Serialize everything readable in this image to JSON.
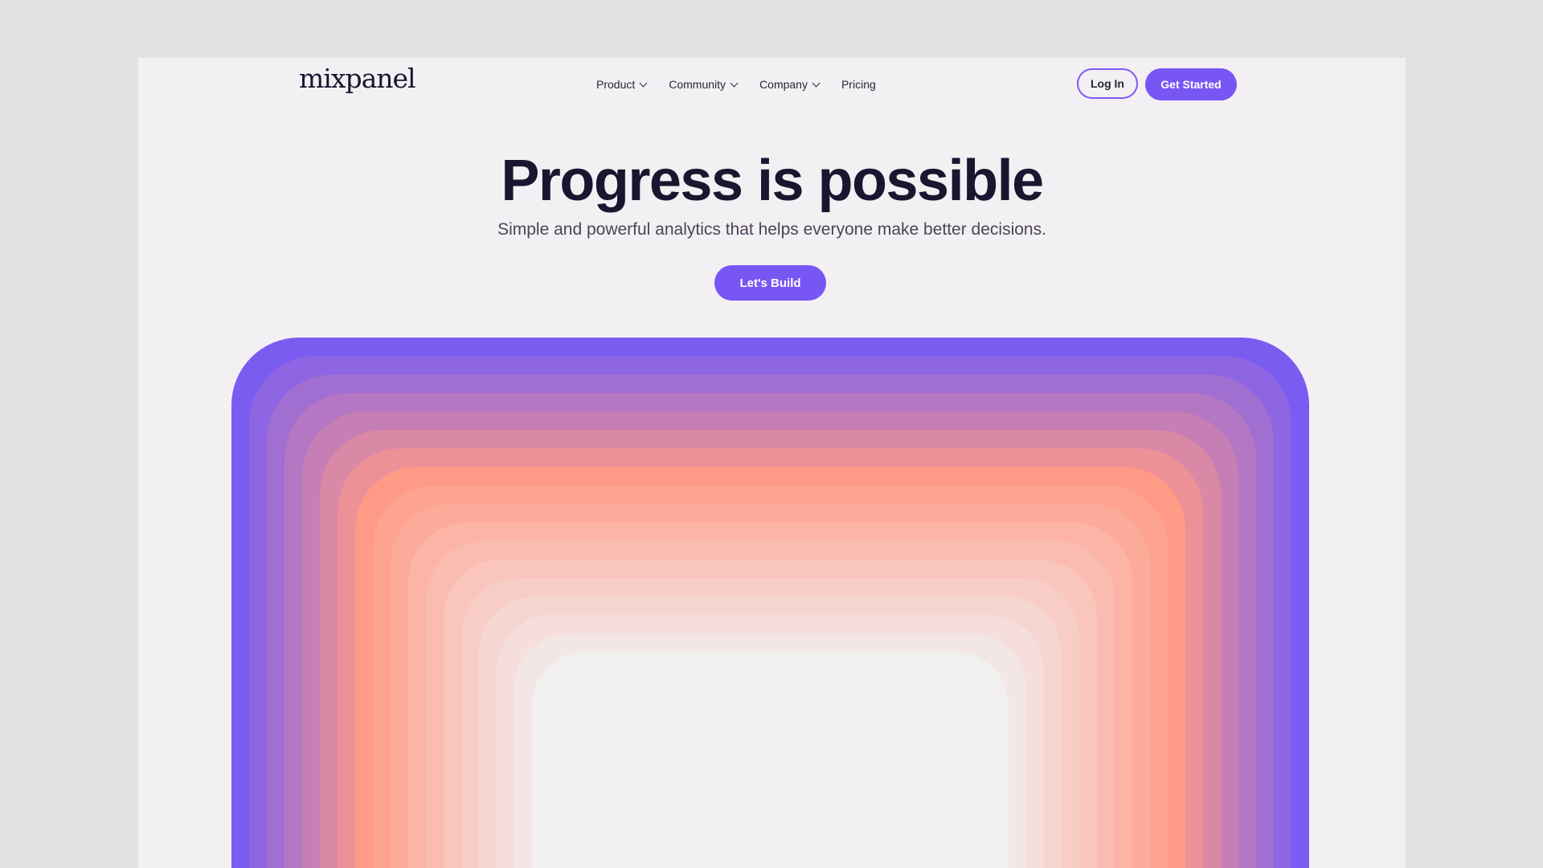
{
  "header": {
    "logo": "mixpanel",
    "nav": [
      "Product",
      "Community",
      "Company",
      "Pricing"
    ],
    "login_label": "Log In",
    "cta_label": "Get Started"
  },
  "hero": {
    "title": "Progress is possible",
    "subtitle": "Simple and powerful analytics that helps everyone make better decisions.",
    "cta_label": "Let's Build"
  },
  "colors": {
    "accent": "#7856f3",
    "background": "#f3f0f3",
    "title": "#1b1530",
    "art_outer": "#7b5cf1",
    "art_mid": "#ff9a86",
    "art_inner": "#f2eff1"
  }
}
